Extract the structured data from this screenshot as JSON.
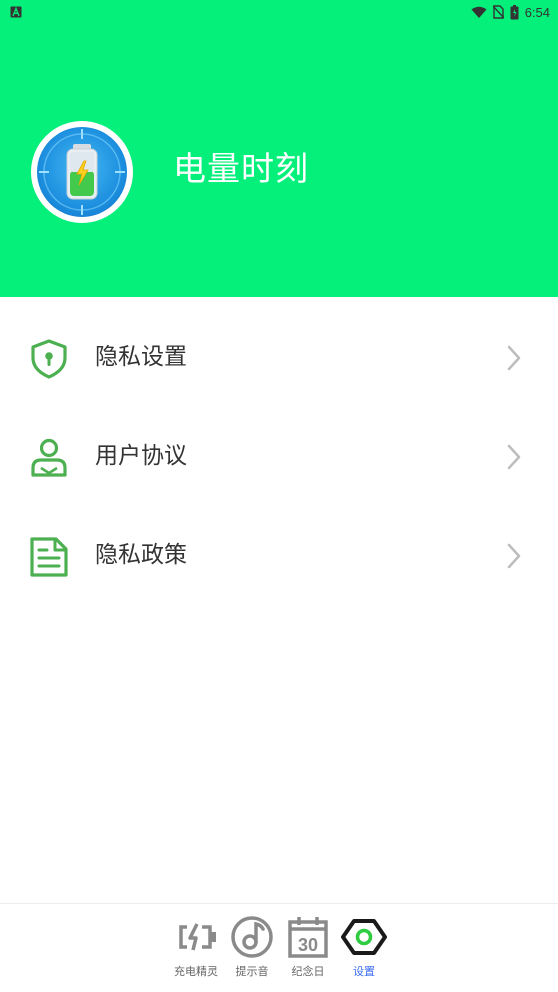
{
  "status_bar": {
    "time": "6:54",
    "notification_icon": "a-notification-icon",
    "icons": [
      "wifi-icon",
      "no-sim-icon",
      "battery-icon"
    ]
  },
  "header": {
    "app_name": "电量时刻",
    "background_color": "#05ef7b",
    "logo": "battery-logo-icon"
  },
  "menu": {
    "items": [
      {
        "label": "隐私设置",
        "icon": "shield-lock-icon"
      },
      {
        "label": "用户协议",
        "icon": "user-icon"
      },
      {
        "label": "隐私政策",
        "icon": "document-icon"
      }
    ],
    "icon_color": "#4caf50"
  },
  "bottom_nav": {
    "items": [
      {
        "label": "充电精灵",
        "icon": "charging-battery-icon"
      },
      {
        "label": "提示音",
        "icon": "music-disc-icon"
      },
      {
        "label": "纪念日",
        "icon": "calendar-icon",
        "day": "30"
      },
      {
        "label": "设置",
        "icon": "hexagon-settings-icon",
        "active": true
      }
    ],
    "active_color": "#3d6df0"
  }
}
